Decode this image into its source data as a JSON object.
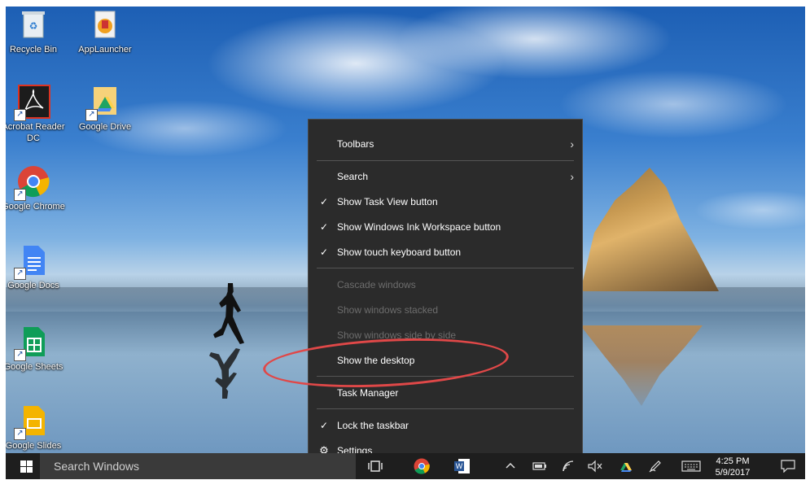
{
  "desktop": {
    "icons": [
      {
        "label": "Recycle Bin",
        "icon": "recycle-bin-icon"
      },
      {
        "label": "AppLauncher",
        "icon": "app-launcher-icon"
      },
      {
        "label": "Acrobat Reader DC",
        "icon": "acrobat-reader-icon"
      },
      {
        "label": "Google Drive",
        "icon": "google-drive-icon"
      },
      {
        "label": "Google Chrome",
        "icon": "chrome-icon"
      },
      {
        "label": "Google Docs",
        "icon": "google-docs-icon"
      },
      {
        "label": "Google Sheets",
        "icon": "google-sheets-icon"
      },
      {
        "label": "Google Slides",
        "icon": "google-slides-icon"
      }
    ]
  },
  "context_menu": {
    "items": [
      {
        "label": "Toolbars",
        "submenu": true
      },
      {
        "label": "Search",
        "submenu": true
      },
      {
        "label": "Show Task View button",
        "checked": true
      },
      {
        "label": "Show Windows Ink Workspace button",
        "checked": true
      },
      {
        "label": "Show touch keyboard button",
        "checked": true
      },
      {
        "label": "Cascade windows",
        "disabled": true
      },
      {
        "label": "Show windows stacked",
        "disabled": true
      },
      {
        "label": "Show windows side by side",
        "disabled": true
      },
      {
        "label": "Show the desktop",
        "highlighted_annotation": true
      },
      {
        "label": "Task Manager"
      },
      {
        "label": "Lock the taskbar",
        "checked": true
      },
      {
        "label": "Settings",
        "icon": "gear-icon"
      }
    ],
    "check_glyph": "✓",
    "arrow_glyph": "›",
    "gear_glyph": "⚙"
  },
  "taskbar": {
    "search_placeholder": "Search Windows",
    "clock_time": "4:25 PM",
    "clock_date": "5/9/2017"
  },
  "colors": {
    "menu_bg": "#2b2b2b",
    "annotation": "#e04848",
    "taskbar_bg": "#1e1e1e"
  }
}
